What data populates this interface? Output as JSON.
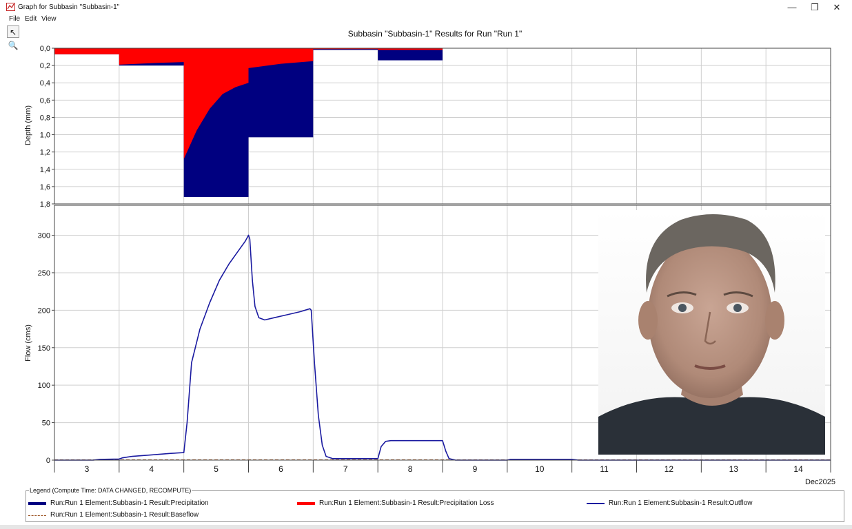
{
  "window": {
    "title": "Graph for Subbasin \"Subbasin-1\"",
    "controls": {
      "minimize": "—",
      "maximize": "❐",
      "close": "✕"
    }
  },
  "menu": [
    "File",
    "Edit",
    "View"
  ],
  "tools": {
    "pointer": "↖",
    "zoom": "🔍"
  },
  "chart_data": {
    "type": "bar+line",
    "title": "Subbasin \"Subbasin-1\" Results for Run \"Run 1\"",
    "x_axis": {
      "ticks": [
        "3",
        "4",
        "5",
        "6",
        "7",
        "8",
        "9",
        "10",
        "11",
        "12",
        "13",
        "14"
      ],
      "date_label": "Dec2025",
      "range": [
        2.5,
        14.5
      ]
    },
    "upper": {
      "ylabel": "Depth (mm)",
      "ylim": [
        0,
        1.8
      ],
      "inverted": true,
      "tick_labels": [
        "0,0",
        "0,2",
        "0,4",
        "0,6",
        "0,8",
        "1,0",
        "1,2",
        "1,4",
        "1,6",
        "1,8"
      ],
      "grid": true,
      "precipitation": {
        "name": "Run:Run 1 Element:Subbasin-1 Result:Precipitation",
        "color": "#000080",
        "bars": [
          {
            "day": 3,
            "value": 0.07
          },
          {
            "day": 4,
            "value": 0.2
          },
          {
            "day": 5,
            "value": 1.72
          },
          {
            "day": 6,
            "value": 1.03
          },
          {
            "day": 7,
            "value": 0.02
          },
          {
            "day": 8,
            "value": 0.14
          }
        ]
      },
      "precipitation_loss": {
        "name": "Run:Run 1 Element:Subbasin-1 Result:Precipitation Loss",
        "color": "#ff0000",
        "profile": [
          [
            2.5,
            0.07
          ],
          [
            3.5,
            0.07
          ],
          [
            3.5,
            0.19
          ],
          [
            4.1,
            0.17
          ],
          [
            4.5,
            0.16
          ],
          [
            4.5,
            1.28
          ],
          [
            4.7,
            0.95
          ],
          [
            4.9,
            0.7
          ],
          [
            5.1,
            0.53
          ],
          [
            5.3,
            0.45
          ],
          [
            5.5,
            0.4
          ],
          [
            5.5,
            0.23
          ],
          [
            5.7,
            0.21
          ],
          [
            6.0,
            0.18
          ],
          [
            6.5,
            0.15
          ],
          [
            6.5,
            0.01
          ],
          [
            7.5,
            0.01
          ],
          [
            7.5,
            0.02
          ],
          [
            8.5,
            0.02
          ]
        ]
      }
    },
    "lower": {
      "ylabel": "Flow (cms)",
      "ylim": [
        0,
        340
      ],
      "tick_values": [
        0,
        50,
        100,
        150,
        200,
        250,
        300
      ],
      "grid": true,
      "outflow": {
        "name": "Run:Run 1 Element:Subbasin-1 Result:Outflow",
        "color": "#1a1aa0",
        "points": [
          [
            2.5,
            0
          ],
          [
            3.1,
            0
          ],
          [
            3.2,
            1
          ],
          [
            3.5,
            1.5
          ],
          [
            3.55,
            3
          ],
          [
            3.7,
            5
          ],
          [
            4.0,
            7
          ],
          [
            4.3,
            9
          ],
          [
            4.5,
            10
          ],
          [
            4.55,
            50
          ],
          [
            4.62,
            130
          ],
          [
            4.75,
            175
          ],
          [
            4.9,
            210
          ],
          [
            5.05,
            240
          ],
          [
            5.2,
            262
          ],
          [
            5.35,
            280
          ],
          [
            5.45,
            292
          ],
          [
            5.5,
            300
          ],
          [
            5.52,
            295
          ],
          [
            5.56,
            240
          ],
          [
            5.6,
            205
          ],
          [
            5.66,
            190
          ],
          [
            5.75,
            187
          ],
          [
            5.9,
            190
          ],
          [
            6.1,
            194
          ],
          [
            6.3,
            198
          ],
          [
            6.45,
            202
          ],
          [
            6.47,
            200
          ],
          [
            6.52,
            130
          ],
          [
            6.58,
            60
          ],
          [
            6.64,
            20
          ],
          [
            6.7,
            5
          ],
          [
            6.8,
            2
          ],
          [
            7.0,
            2
          ],
          [
            7.5,
            2
          ],
          [
            7.55,
            18
          ],
          [
            7.62,
            25
          ],
          [
            7.7,
            26
          ],
          [
            8.0,
            26
          ],
          [
            8.5,
            26
          ],
          [
            8.55,
            12
          ],
          [
            8.6,
            2
          ],
          [
            8.7,
            0
          ],
          [
            9.5,
            0
          ],
          [
            9.55,
            1
          ],
          [
            9.8,
            1
          ],
          [
            10.5,
            1
          ],
          [
            10.6,
            0
          ],
          [
            14.5,
            0
          ]
        ]
      },
      "baseflow": {
        "name": "Run:Run 1 Element:Subbasin-1 Result:Baseflow",
        "color": "#a05a2c",
        "points": [
          [
            2.5,
            0
          ],
          [
            14.5,
            0
          ]
        ]
      }
    },
    "legend": {
      "title": "Legend (Compute Time: DATA CHANGED, RECOMPUTE)",
      "placement": "bottom"
    }
  }
}
